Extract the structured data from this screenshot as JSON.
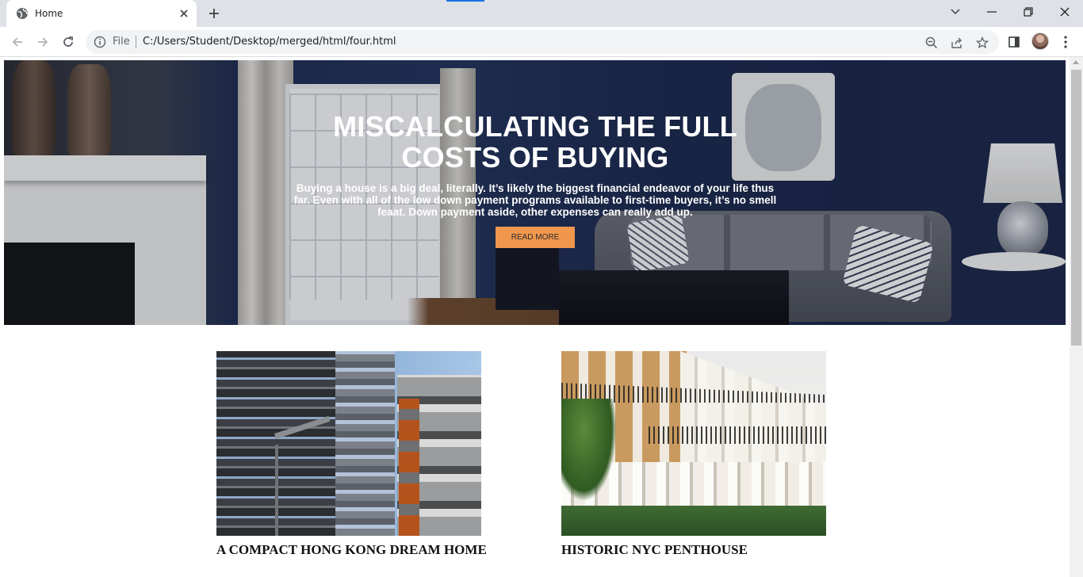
{
  "browser": {
    "tab_title": "Home",
    "address_chip": "File",
    "url": "C:/Users/Student/Desktop/merged/html/four.html"
  },
  "hero": {
    "title": "MISCALCULATING THE FULL COSTS OF BUYING",
    "text": "Buying a house is a big deal, literally. It’s likely the biggest financial endeavor of your life thus far. Even with all of the low down payment programs available to first-time buyers, it’s no smell feaat. Down payment aside, other expenses can really add up.",
    "button_label": "READ MORE"
  },
  "cards": [
    {
      "title": "A COMPACT HONG KONG DREAM HOME"
    },
    {
      "title": "HISTORIC NYC PENTHOUSE"
    }
  ],
  "colors": {
    "accent_button": "#f0974e",
    "hero_wall": "#223358"
  }
}
